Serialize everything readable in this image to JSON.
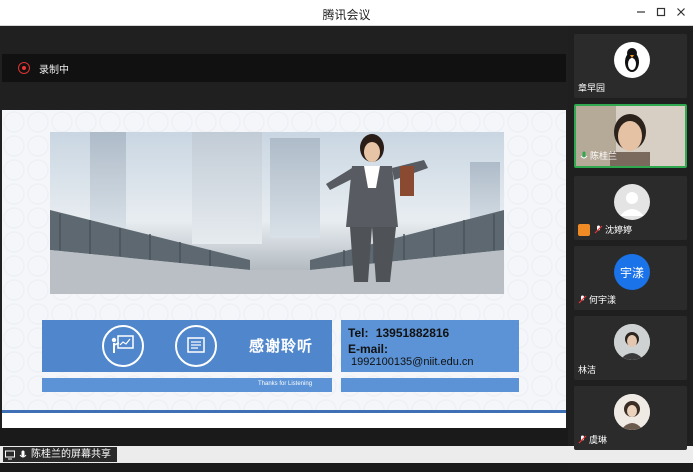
{
  "window": {
    "title": "腾讯会议",
    "controls": [
      "minimize",
      "maximize",
      "close"
    ]
  },
  "recording": {
    "label": "录制中"
  },
  "slide": {
    "thanks_cn": "感谢聆听",
    "thanks_en": "Thanks for Listening",
    "tel_label": "Tel:",
    "tel_number": "13951882816",
    "email_label": "E-mail:",
    "email_address": "1992100135@niit.edu.cn"
  },
  "share": {
    "label": "陈桂兰的屏幕共享"
  },
  "participants": [
    {
      "name": "章早园",
      "avatar": "penguin-icon",
      "video": false,
      "muted": false
    },
    {
      "name": "陈桂兰",
      "avatar": "camera-feed",
      "video": true,
      "muted": false,
      "speaking": true
    },
    {
      "name": "沈婷婷",
      "avatar": "default-user-icon",
      "video": false,
      "muted": true
    },
    {
      "name": "何宇漾",
      "avatar": "text-avatar",
      "avatar_text": "宇漾",
      "video": false,
      "muted": true
    },
    {
      "name": "林洁",
      "avatar": "photo-avatar",
      "video": false,
      "muted": false
    },
    {
      "name": "虞琳",
      "avatar": "photo-avatar",
      "video": false,
      "muted": true
    }
  ],
  "colors": {
    "accent_blue": "#4f86cc",
    "speaking_green": "#2fa84f",
    "recording_red": "#e33333",
    "text_avatar_blue": "#1a73e8"
  }
}
